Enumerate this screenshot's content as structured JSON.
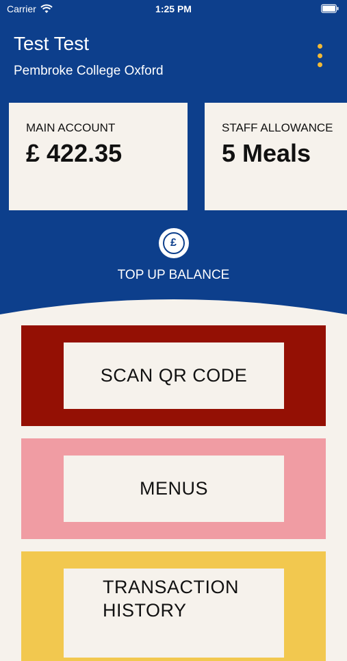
{
  "status_bar": {
    "carrier": "Carrier",
    "time": "1:25 PM"
  },
  "user": {
    "name": "Test Test",
    "college": "Pembroke College Oxford"
  },
  "accounts": [
    {
      "label": "MAIN ACCOUNT",
      "value": "£ 422.35"
    },
    {
      "label": "STAFF ALLOWANCE",
      "value": "5 Meals"
    }
  ],
  "top_up": {
    "icon_glyph": "£",
    "label": "TOP UP BALANCE"
  },
  "actions": [
    {
      "label": "SCAN QR CODE",
      "color": "#941004"
    },
    {
      "label": "MENUS",
      "color": "#f09ca3"
    },
    {
      "label": "TRANSACTION HISTORY",
      "color": "#f2c84f"
    }
  ],
  "theme": {
    "header_color": "#0d3f8c",
    "background_color": "#f6f2ec",
    "accent_color": "#f2b935"
  },
  "icons": [
    "wifi-icon",
    "battery-icon",
    "more-vertical-icon",
    "pound-icon"
  ]
}
